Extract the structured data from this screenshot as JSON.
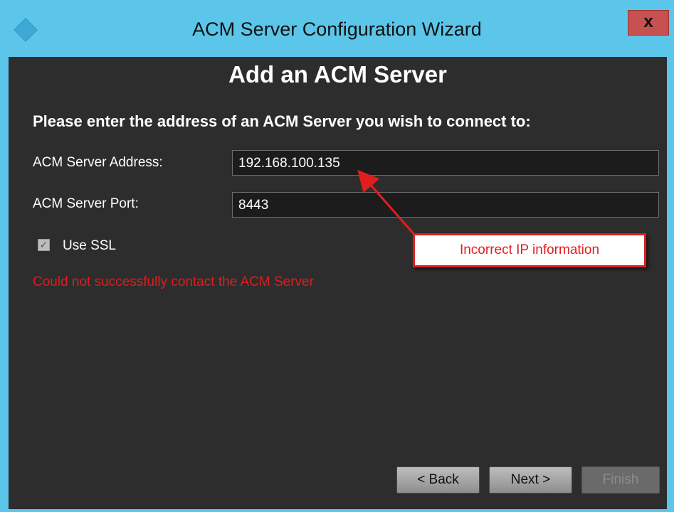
{
  "window": {
    "title": "ACM Server Configuration Wizard",
    "close_label": "x"
  },
  "page": {
    "heading": "Add an ACM Server",
    "prompt": "Please enter the address of an ACM Server you wish to connect to:"
  },
  "form": {
    "address_label": "ACM Server Address:",
    "address_value": "192.168.100.135",
    "port_label": "ACM Server Port:",
    "port_value": "8443",
    "ssl_label": "Use SSL",
    "ssl_checked": true,
    "error_message": "Could not successfully contact the ACM Server"
  },
  "annotation": {
    "callout_text": "Incorrect IP information"
  },
  "buttons": {
    "back": "< Back",
    "next": "Next >",
    "finish": "Finish"
  },
  "colors": {
    "titlebar": "#5bc6ea",
    "background": "#2d2d2d",
    "error": "#e11c1c",
    "close": "#c75050"
  }
}
